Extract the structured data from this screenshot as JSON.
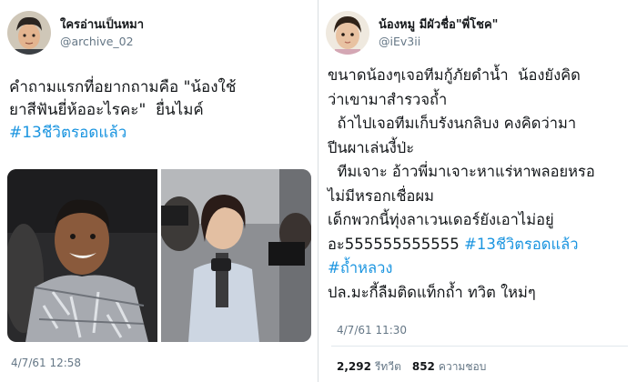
{
  "left_tweet": {
    "display_name": "ใครอ่านเป็นหมา",
    "handle": "@archive_02",
    "text_line1": "คำถามแรกที่อยากถามคือ \"น้องใช้",
    "text_line2": "ยาสีฟันยี่ห้ออะไรคะ\"  ยื่นไมค์",
    "hashtag": "#13ชีวิตรอดแล้ว",
    "timestamp": "4/7/61 12:58",
    "avatar_icon": "person-avatar-icon",
    "photos": [
      "rescued-boy-photo",
      "reporter-with-microphone-photo"
    ]
  },
  "right_tweet": {
    "display_name": "น้องหมู มีผัวชื่อ\"พี่โชค\"",
    "handle": "@iEv3ii",
    "lines": [
      "ขนาดน้องๆเจอทีมกู้ภัยดำน้ำ  น้องยังคิด",
      "ว่าเขามาสำรวจถ้ำ",
      "  ถ้าไปเจอทีมเก็บรังนกลิบง คงคิดว่ามา",
      "ปีนผาเล่นงี้ป่ะ",
      "  ทีมเจาะ อ้าวพี่มาเจาะหาแร่หาพลอยหรอ",
      "ไม่มีหรอกเชื่อผม",
      "เด็กพวกนี้ทุ่งลาเวนเดอร์ยังเอาไม่อยู่"
    ],
    "line8_prefix": "อะ555555555555 ",
    "line8_hashtag": "#13ชีวิตรอดแล้ว",
    "line9_hashtag": "#ถ้ำหลวง",
    "line10": "ปล.มะกี้ลืมติดแท็กถ้ำ ทวิต ใหม่ๆ",
    "timestamp": "4/7/61 11:30",
    "retweet_count": "2,292",
    "retweet_label": "รีทวีต",
    "like_count": "852",
    "like_label": "ความชอบ",
    "avatar_icon": "child-avatar-icon"
  },
  "colors": {
    "hashtag": "#1b95e0",
    "secondary_text": "#657786",
    "primary_text": "#14171a"
  }
}
